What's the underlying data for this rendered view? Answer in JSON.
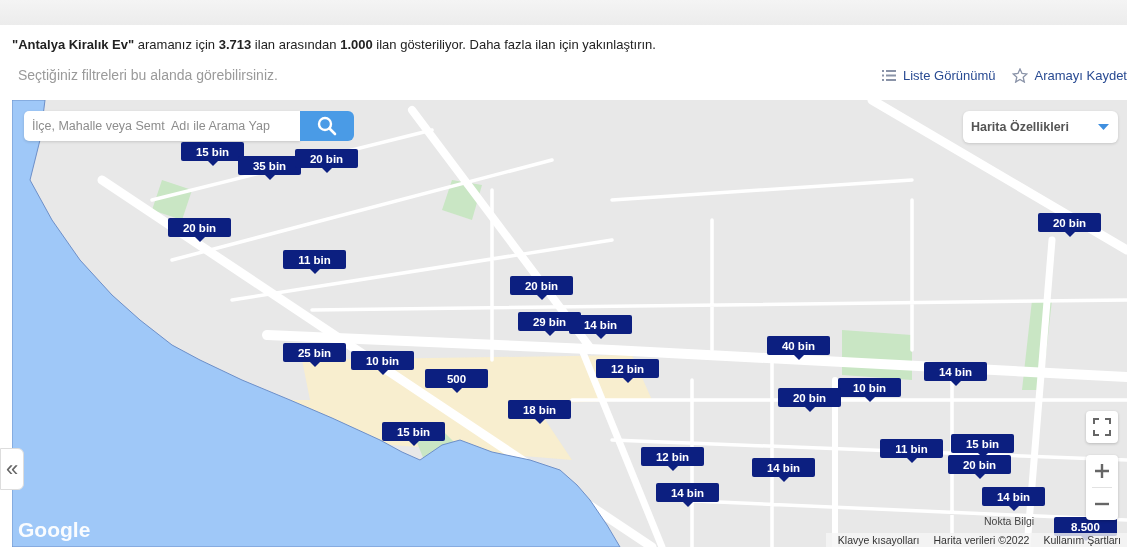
{
  "header": {
    "summary": "**\"Antalya Kiralık Ev\"** aramanız için **3.713** ilan arasından **1.000** ilan gösteriliyor. Daha fazla ilan için yakınlaştırın.",
    "filter_hint": "Seçtiğiniz filtreleri bu alanda görebilirsiniz.",
    "actions": [
      {
        "kind": "list",
        "label": "Liste Görünümü"
      },
      {
        "kind": "star",
        "label": "Aramayı Kaydet"
      }
    ]
  },
  "map": {
    "search": {
      "placeholder": "İlçe, Mahalle veya Semt  Adı ile Arama Yap"
    },
    "layers_dropdown": {
      "label": "Harita Özellikleri"
    },
    "collapse_button": "«",
    "markers": [
      {
        "label": "15 bin"
      },
      {
        "label": "35 bin"
      },
      {
        "label": "20 bin"
      },
      {
        "label": "20 bin"
      },
      {
        "label": "11 bin"
      },
      {
        "label": "20 bin"
      },
      {
        "label": "29 bin"
      },
      {
        "label": "14 bin"
      },
      {
        "label": "40 bin"
      },
      {
        "label": "25 bin"
      },
      {
        "label": "10 bin"
      },
      {
        "label": "12 bin"
      },
      {
        "label": "500"
      },
      {
        "label": "14 bin"
      },
      {
        "label": "10 bin"
      },
      {
        "label": "20 bin"
      },
      {
        "label": "18 bin"
      },
      {
        "label": "15 bin"
      },
      {
        "label": "11 bin"
      },
      {
        "label": "15 bin"
      },
      {
        "label": "12 bin"
      },
      {
        "label": "20 bin"
      },
      {
        "label": "14 bin"
      },
      {
        "label": "14 bin"
      },
      {
        "label": "14 bin"
      },
      {
        "label": "20 bin"
      },
      {
        "label": "8.500"
      }
    ],
    "attribution": "Nokta Bilgi",
    "footer_links": [
      "Klavye kısayolları",
      "Harita verileri ©2022",
      "Kullanım Şartları"
    ],
    "logo": "Google"
  }
}
